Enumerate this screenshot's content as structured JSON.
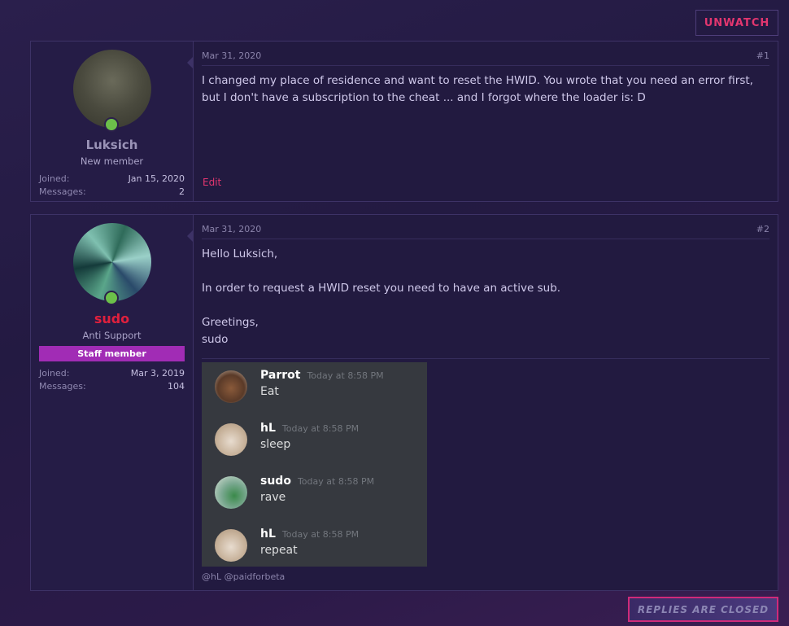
{
  "header": {
    "unwatch_label": "UNWATCH"
  },
  "posts": [
    {
      "username": "Luksich",
      "user_title": "New member",
      "joined_label": "Joined:",
      "joined_value": "Jan 15, 2020",
      "messages_label": "Messages:",
      "messages_value": "2",
      "date": "Mar 31, 2020",
      "number": "#1",
      "body": "I changed my place of residence and want to reset the HWID. You wrote that you need an error first, but I don't have a subscription to the cheat ... and I forgot where the loader is: D",
      "edit_label": "Edit"
    },
    {
      "username": "sudo",
      "user_title": "Anti Support",
      "staff_badge": "Staff member",
      "joined_label": "Joined:",
      "joined_value": "Mar 3, 2019",
      "messages_label": "Messages:",
      "messages_value": "104",
      "date": "Mar 31, 2020",
      "number": "#2",
      "body_lines": [
        "Hello Luksich,",
        "In order to request a HWID reset you need to have an active sub.",
        "Greetings,",
        "sudo"
      ],
      "discord": [
        {
          "name": "Parrot",
          "time": "Today at 8:58 PM",
          "text": "Eat"
        },
        {
          "name": "hL",
          "time": "Today at 8:58 PM",
          "text": "sleep"
        },
        {
          "name": "sudo",
          "time": "Today at 8:58 PM",
          "text": "rave"
        },
        {
          "name": "hL",
          "time": "Today at 8:58 PM",
          "text": "repeat"
        }
      ],
      "signature": "@hL @paidforbeta"
    }
  ],
  "footer": {
    "closed_label": "REPLIES ARE CLOSED"
  }
}
